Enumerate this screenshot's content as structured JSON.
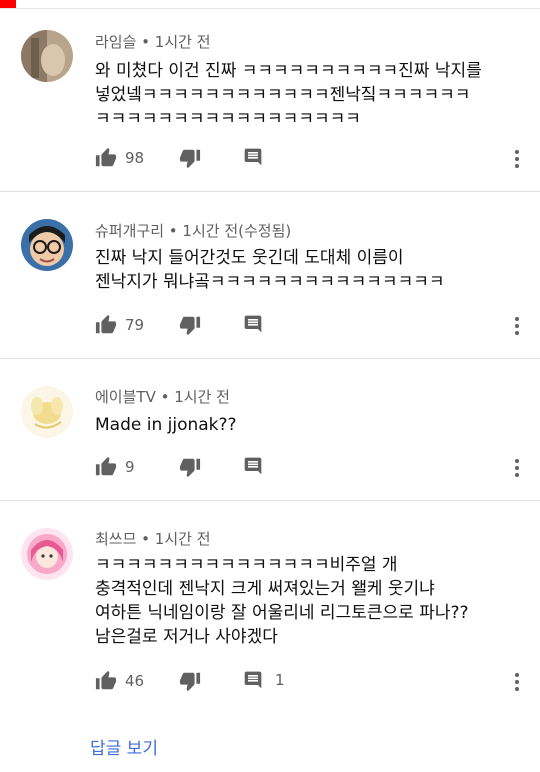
{
  "comments": [
    {
      "author": "라임슬",
      "time": "1시간 전",
      "text": "와 미쳤다 이건 진짜 ㅋㅋㅋㅋㅋㅋㅋㅋㅋㅋ진짜 낙지를\n넣었넼ㅋㅋㅋㅋㅋㅋㅋㅋㅋㅋㅋㅋ젠낙짘ㅋㅋㅋㅋㅋㅋ\nㅋㅋㅋㅋㅋㅋㅋㅋㅋㅋㅋㅋㅋㅋㅋㅋㅋ",
      "likes": "98",
      "replies": ""
    },
    {
      "author": "슈퍼개구리",
      "time": "1시간 전(수정됨)",
      "text": "진짜 낙지 들어간것도 웃긴데 도대체 이름이\n젠낙지가 뭐냐곸ㅋㅋㅋㅋㅋㅋㅋㅋㅋㅋㅋㅋㅋㅋㅋ",
      "likes": "79",
      "replies": ""
    },
    {
      "author": "에이블TV",
      "time": "1시간 전",
      "text": "Made in jjonak??",
      "likes": "9",
      "replies": ""
    },
    {
      "author": "최쓰므",
      "time": "1시간 전",
      "text": "ㅋㅋㅋㅋㅋㅋㅋㅋㅋㅋㅋㅋㅋㅋㅋ비주얼 개\n충격적인데 젠낙지 크게 써져있는거 왤케 웃기냐\n여하튼 닉네임이랑 잘 어울리네 리그토큰으로 파나??\n남은걸로 저거나 사야겠다",
      "likes": "46",
      "replies": "1"
    }
  ],
  "view_replies_label": "답글 보기",
  "colors": {
    "accent": "#3e6fd8",
    "red": "#ff0000"
  }
}
